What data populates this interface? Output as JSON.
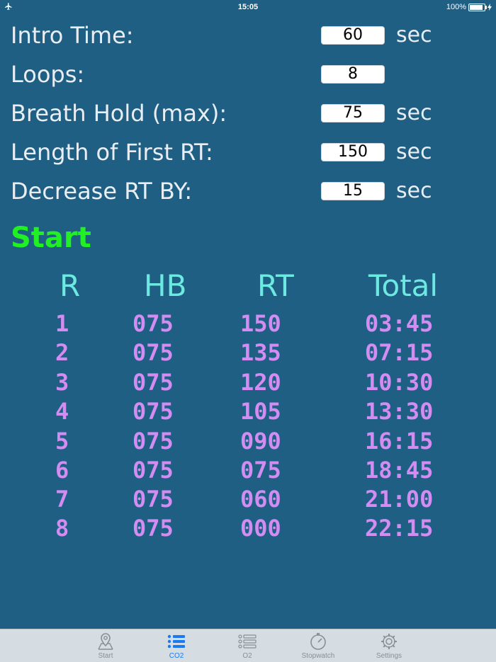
{
  "status_bar": {
    "time": "15:05",
    "battery": "100%",
    "battery_level": 1.0
  },
  "settings": [
    {
      "label": "Intro Time:",
      "value": "60",
      "unit": "sec"
    },
    {
      "label": "Loops:",
      "value": "8",
      "unit": ""
    },
    {
      "label": "Breath Hold (max):",
      "value": "75",
      "unit": "sec"
    },
    {
      "label": "Length of First RT:",
      "value": "150",
      "unit": "sec"
    },
    {
      "label": "Decrease RT BY:",
      "value": "15",
      "unit": "sec"
    }
  ],
  "start_label": "Start",
  "table": {
    "headers": {
      "r": "R",
      "hb": "HB",
      "rt": "RT",
      "total": "Total"
    },
    "rows": [
      {
        "r": "1",
        "hb": "075",
        "rt": "150",
        "total": "03:45"
      },
      {
        "r": "2",
        "hb": "075",
        "rt": "135",
        "total": "07:15"
      },
      {
        "r": "3",
        "hb": "075",
        "rt": "120",
        "total": "10:30"
      },
      {
        "r": "4",
        "hb": "075",
        "rt": "105",
        "total": "13:30"
      },
      {
        "r": "5",
        "hb": "075",
        "rt": "090",
        "total": "16:15"
      },
      {
        "r": "6",
        "hb": "075",
        "rt": "075",
        "total": "18:45"
      },
      {
        "r": "7",
        "hb": "075",
        "rt": "060",
        "total": "21:00"
      },
      {
        "r": "8",
        "hb": "075",
        "rt": "000",
        "total": "22:15"
      }
    ]
  },
  "tabs": [
    {
      "label": "Start",
      "icon": "map-pin-icon",
      "active": false
    },
    {
      "label": "CO2",
      "icon": "list-icon",
      "active": true
    },
    {
      "label": "O2",
      "icon": "numbered-list-icon",
      "active": false
    },
    {
      "label": "Stopwatch",
      "icon": "stopwatch-icon",
      "active": false
    },
    {
      "label": "Settings",
      "icon": "gear-icon",
      "active": false
    }
  ],
  "colors": {
    "background": "#1f5f84",
    "start": "#21f025",
    "header": "#6ce9e0",
    "row": "#d38df2",
    "tab_active": "#1a7bf0",
    "tab_inactive": "#8a8f93"
  }
}
